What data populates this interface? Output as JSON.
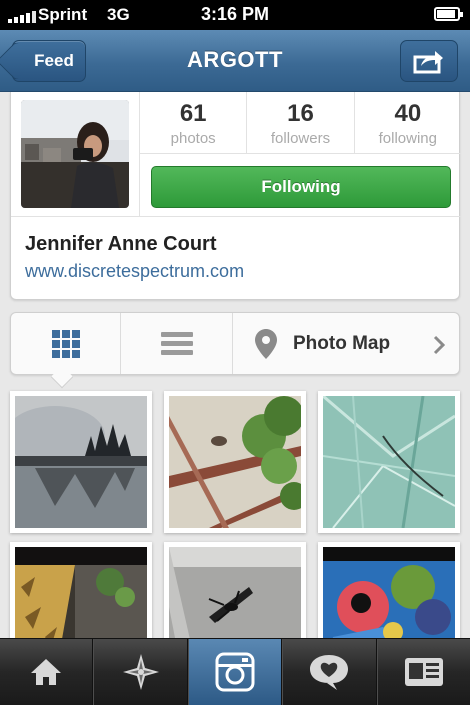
{
  "status_bar": {
    "carrier": "Sprint",
    "network": "3G",
    "time": "3:16 PM"
  },
  "nav": {
    "back_label": "Feed",
    "title": "ARGOTT"
  },
  "profile": {
    "stats": [
      {
        "value": "61",
        "label": "photos"
      },
      {
        "value": "16",
        "label": "followers"
      },
      {
        "value": "40",
        "label": "following"
      }
    ],
    "follow_button_label": "Following",
    "full_name": "Jennifer Anne Court",
    "website": "www.discretespectrum.com"
  },
  "view_tabs": {
    "grid_icon": "grid-icon",
    "list_icon": "list-icon",
    "map_icon": "map-pin-icon",
    "map_label": "Photo Map"
  },
  "tab_bar": {
    "items": [
      "home-icon",
      "explore-icon",
      "camera-icon",
      "news-icon",
      "profile-icon"
    ],
    "active_index": 2
  },
  "colors": {
    "nav_blue": "#3c6a95",
    "follow_green": "#2e9a39",
    "link_blue": "#3d6d9c"
  }
}
